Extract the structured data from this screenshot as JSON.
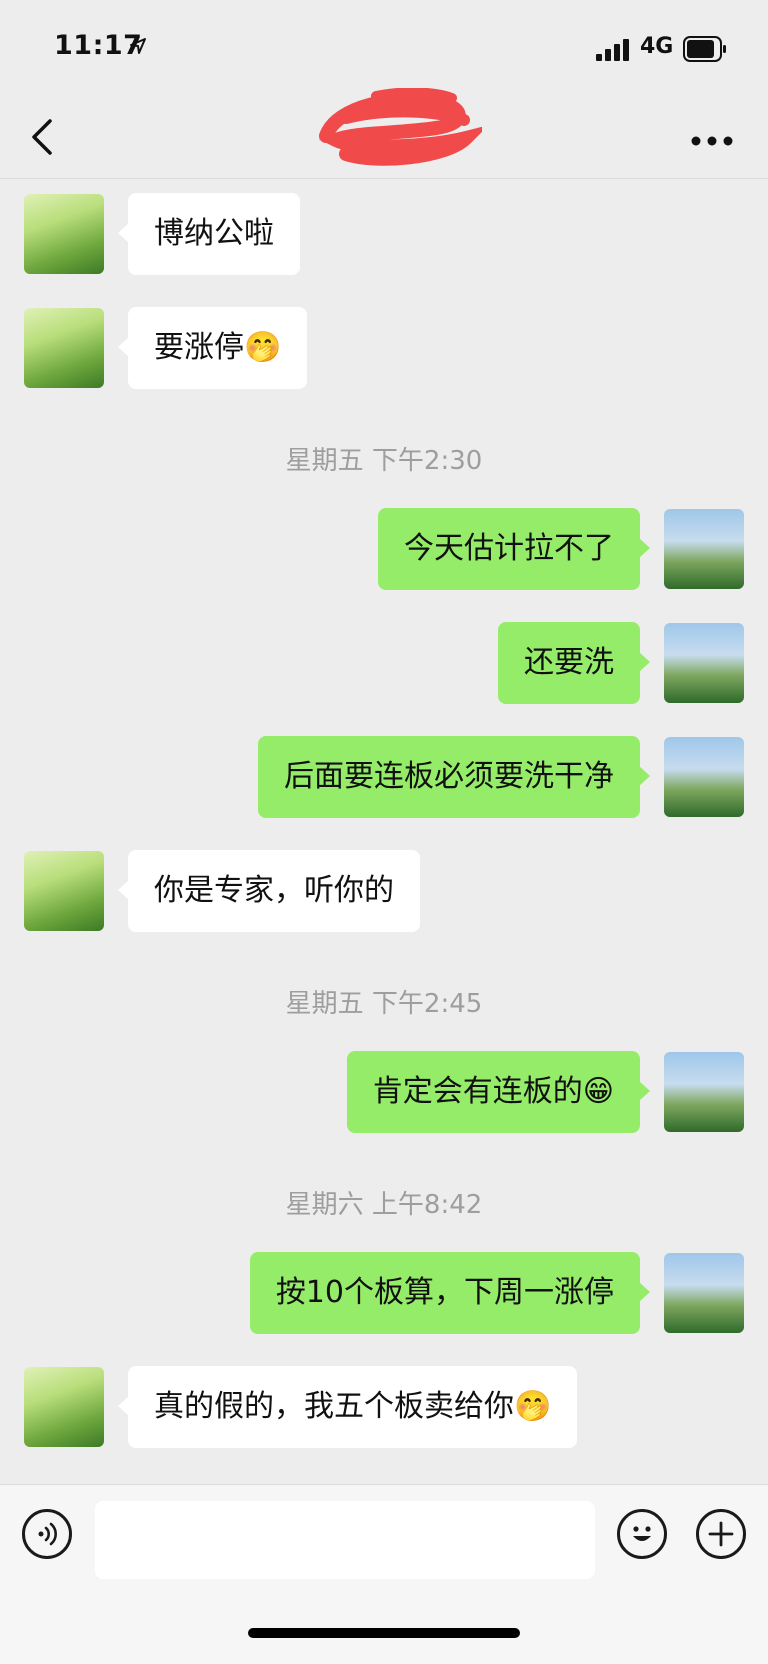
{
  "status_bar": {
    "time": "11:17",
    "network": "4G",
    "location_icon": "location-arrow-icon",
    "signal_icon": "cell-signal-icon",
    "battery_icon": "battery-icon"
  },
  "nav": {
    "back_icon": "chevron-left-icon",
    "title_redacted": true,
    "more_icon": "more-dots-icon"
  },
  "messages": [
    {
      "side": "left",
      "text": "博纳公啦"
    },
    {
      "side": "left",
      "text": "要涨停🤭"
    },
    {
      "type": "timestamp",
      "text": "星期五 下午2:30"
    },
    {
      "side": "right",
      "text": "今天估计拉不了"
    },
    {
      "side": "right",
      "text": "还要洗"
    },
    {
      "side": "right",
      "text": "后面要连板必须要洗干净"
    },
    {
      "side": "left",
      "text": "你是专家，听你的"
    },
    {
      "type": "timestamp",
      "text": "星期五 下午2:45"
    },
    {
      "side": "right",
      "text": "肯定会有连板的😁"
    },
    {
      "type": "timestamp",
      "text": "星期六 上午8:42"
    },
    {
      "side": "right",
      "text": "按10个板算，下周一涨停"
    },
    {
      "side": "left",
      "text": "真的假的，我五个板卖给你🤭"
    }
  ],
  "input_bar": {
    "message_value": "",
    "voice_icon": "voice-input-icon",
    "emoji_icon": "emoji-icon",
    "plus_icon": "plus-icon"
  },
  "colors": {
    "background": "#ededed",
    "sent_bubble": "#95ec69",
    "received_bubble": "#ffffff",
    "timestamp": "#9e9e9e",
    "redaction": "#f04a4a"
  }
}
